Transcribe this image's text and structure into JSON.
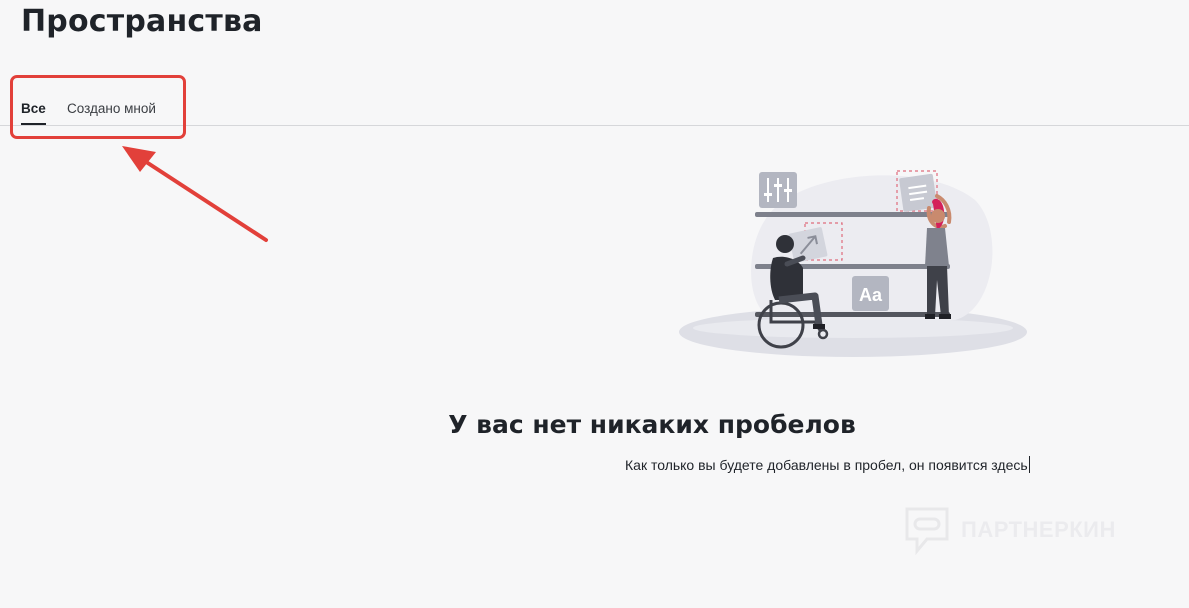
{
  "page": {
    "title": "Пространства"
  },
  "tabs": [
    {
      "label": "Все",
      "active": true
    },
    {
      "label": "Создано мной",
      "active": false
    }
  ],
  "annotation": {
    "color": "#e2403a"
  },
  "empty_state": {
    "title": "У вас нет никаких пробелов",
    "subtitle": "Как только вы будете добавлены в пробел, он появится здесь",
    "illustration": "people-arranging-shelves-illustration",
    "shelf_tile_label": "Aa"
  },
  "watermark": {
    "text": "ПАРТНЕРКИН",
    "icon": "chat-bubble-icon"
  }
}
